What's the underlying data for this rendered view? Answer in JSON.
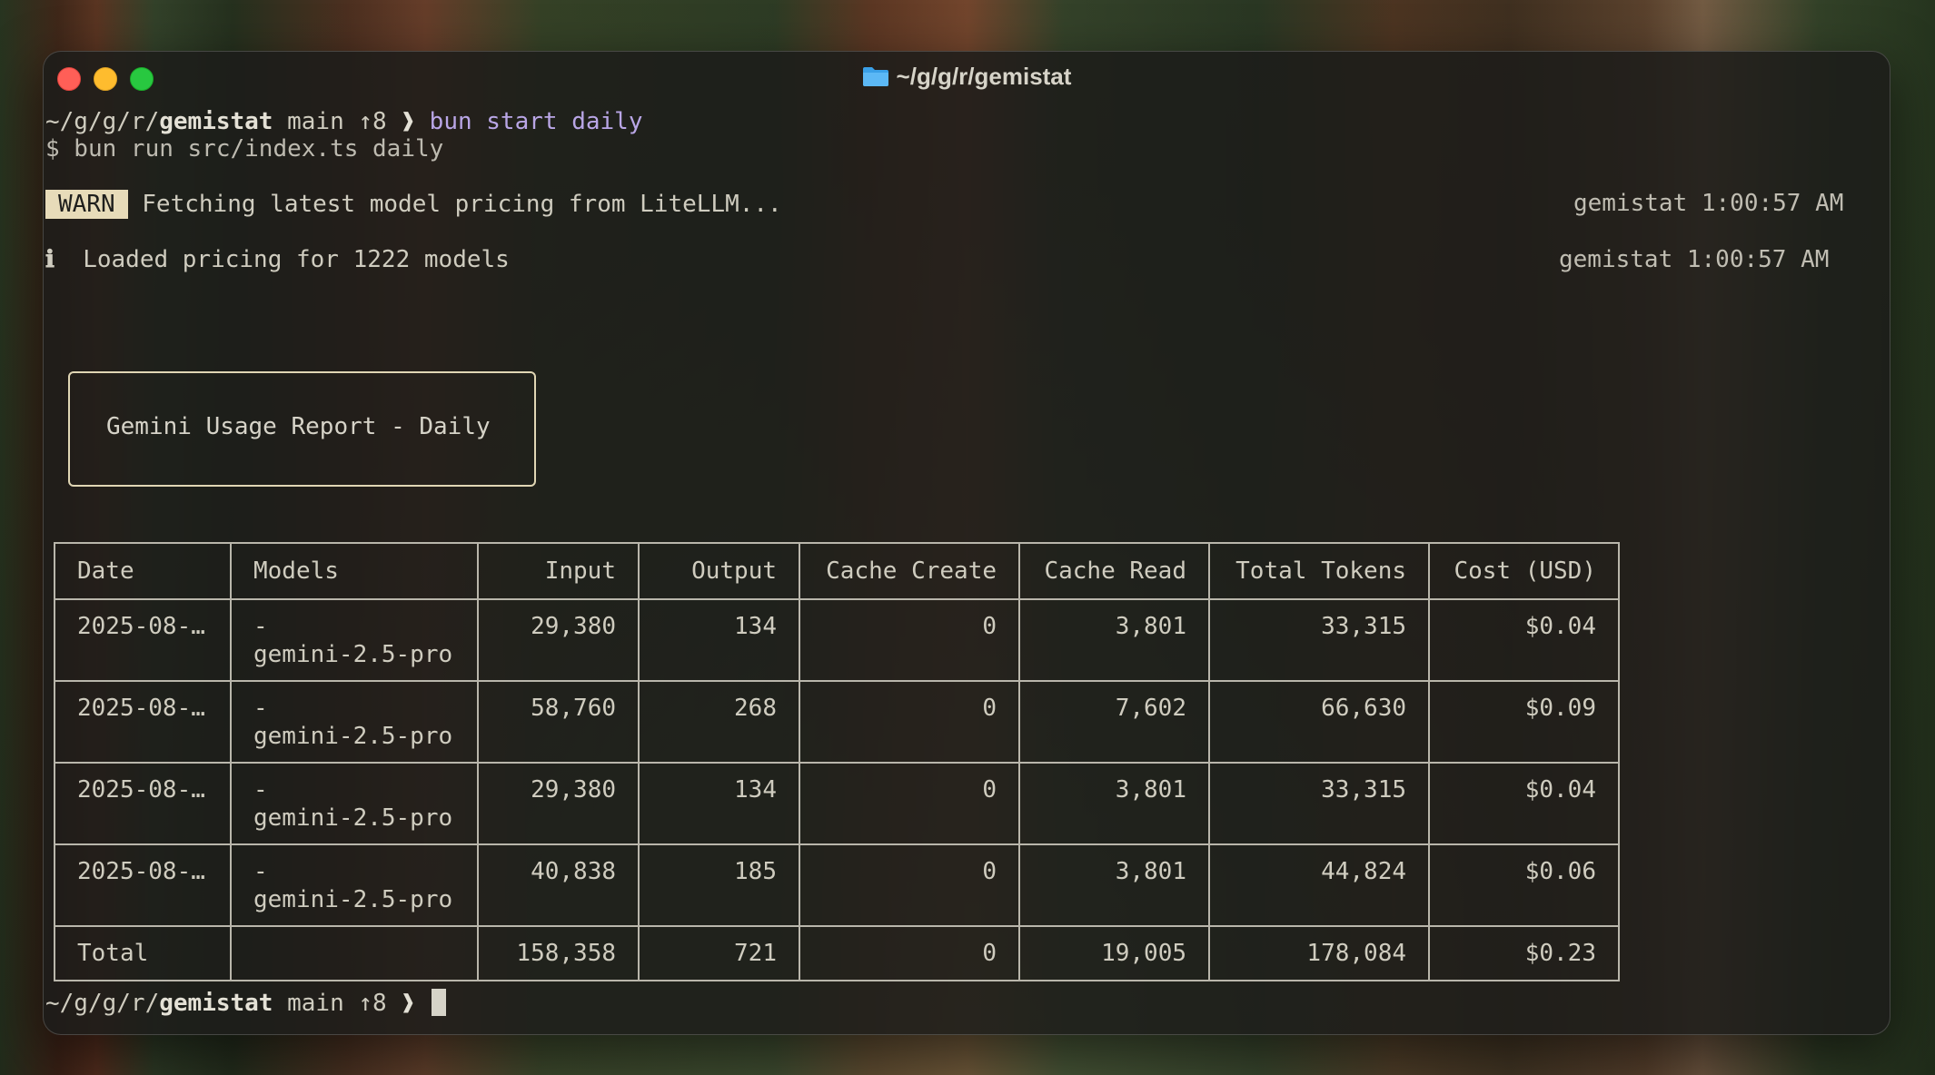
{
  "window": {
    "title": "~/g/g/r/gemistat"
  },
  "prompt1": {
    "path_prefix": "~/g/g/r/",
    "dir": "gemistat",
    "branch": " main ↑8 ",
    "arrow": "❱",
    "command": " bun start daily"
  },
  "exec_line": "$ bun run src/index.ts daily",
  "warn": {
    "badge": "WARN",
    "message": "Fetching latest model pricing from LiteLLM...",
    "timestamp": "gemistat 1:00:57 AM"
  },
  "info": {
    "icon": "ℹ",
    "message": "Loaded pricing for 1222 models",
    "timestamp": "gemistat 1:00:57 AM"
  },
  "report": {
    "title": "Gemini Usage Report - Daily"
  },
  "table": {
    "headers": [
      "Date",
      "Models",
      "Input",
      "Output",
      "Cache Create",
      "Cache Read",
      "Total Tokens",
      "Cost (USD)"
    ],
    "rows": [
      {
        "date": "2025-08-…",
        "model_dash": "-",
        "model": "gemini-2.5-pro",
        "input": "29,380",
        "output": "134",
        "cache_create": "0",
        "cache_read": "3,801",
        "total": "33,315",
        "cost": "$0.04"
      },
      {
        "date": "2025-08-…",
        "model_dash": "-",
        "model": "gemini-2.5-pro",
        "input": "58,760",
        "output": "268",
        "cache_create": "0",
        "cache_read": "7,602",
        "total": "66,630",
        "cost": "$0.09"
      },
      {
        "date": "2025-08-…",
        "model_dash": "-",
        "model": "gemini-2.5-pro",
        "input": "29,380",
        "output": "134",
        "cache_create": "0",
        "cache_read": "3,801",
        "total": "33,315",
        "cost": "$0.04"
      },
      {
        "date": "2025-08-…",
        "model_dash": "-",
        "model": "gemini-2.5-pro",
        "input": "40,838",
        "output": "185",
        "cache_create": "0",
        "cache_read": "3,801",
        "total": "44,824",
        "cost": "$0.06"
      }
    ],
    "total": {
      "label": "Total",
      "input": "158,358",
      "output": "721",
      "cache_create": "0",
      "cache_read": "19,005",
      "total": "178,084",
      "cost": "$0.23"
    }
  },
  "prompt2": {
    "path_prefix": "~/g/g/r/",
    "dir": "gemistat",
    "branch": " main ↑8 ",
    "arrow": "❱"
  },
  "icons": {
    "folder": "folder-icon",
    "info": "info-icon"
  },
  "colors": {
    "close": "#ff5f57",
    "minimize": "#febc2e",
    "maximize": "#28c840",
    "command": "#b9a6e6",
    "warn_badge": "#e7dbb9"
  }
}
